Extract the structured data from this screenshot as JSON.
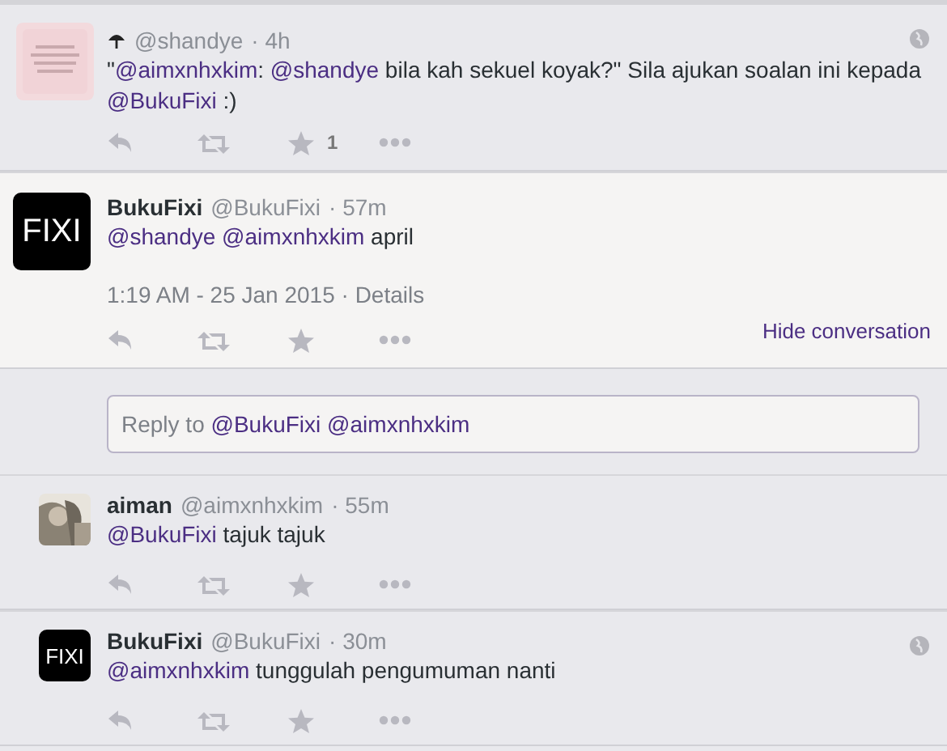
{
  "tweets": [
    {
      "kind": "root",
      "avatar": {
        "kind": "picture"
      },
      "prefix_icon": true,
      "handle": "@shandye",
      "time": "· 4h",
      "globe": true,
      "text": [
        {
          "kind": "plain",
          "text": "\""
        },
        {
          "kind": "mention",
          "text": "@aimxnhxkim"
        },
        {
          "kind": "plain",
          "text": ": "
        },
        {
          "kind": "mention",
          "text": "@shandye"
        },
        {
          "kind": "plain",
          "text": " bila kah sekuel koyak?\" Sila ajukan soalan ini kepada "
        },
        {
          "kind": "mention",
          "text": "@BukuFixi"
        },
        {
          "kind": "plain",
          "text": " :)"
        }
      ],
      "favorite_count": "1"
    },
    {
      "kind": "focused",
      "avatar": {
        "kind": "logo",
        "text": "FIXI"
      },
      "name": "BukuFixi",
      "handle": "@BukuFixi",
      "time": "· 57m",
      "globe": false,
      "text": [
        {
          "kind": "mention",
          "text": "@shandye"
        },
        {
          "kind": "mention",
          "text": "@aimxnhxkim"
        },
        {
          "kind": "plain",
          "text": " april"
        }
      ],
      "timestamp": "1:19 AM - 25 Jan 2015",
      "details": "· Details",
      "hide_link": "Hide conversation"
    },
    {
      "kind": "reply-box",
      "label": "Reply to ",
      "mentions": [
        "@BukuFixi",
        "@aimxnhxkim"
      ]
    },
    {
      "kind": "reply",
      "avatar": {
        "kind": "picture"
      },
      "name": "aiman",
      "handle": "@aimxnhxkim",
      "time": "· 55m",
      "globe": false,
      "text": [
        {
          "kind": "mention",
          "text": "@BukuFixi"
        },
        {
          "kind": "plain",
          "text": " tajuk tajuk"
        }
      ]
    },
    {
      "kind": "reply",
      "avatar": {
        "kind": "logo",
        "text": "FIXI"
      },
      "name": "BukuFixi",
      "handle": "@BukuFixi",
      "time": "· 30m",
      "globe": true,
      "text": [
        {
          "kind": "mention",
          "text": "@aimxnhxkim"
        },
        {
          "kind": "plain",
          "text": " tunggulah pengumuman nanti"
        }
      ]
    }
  ]
}
